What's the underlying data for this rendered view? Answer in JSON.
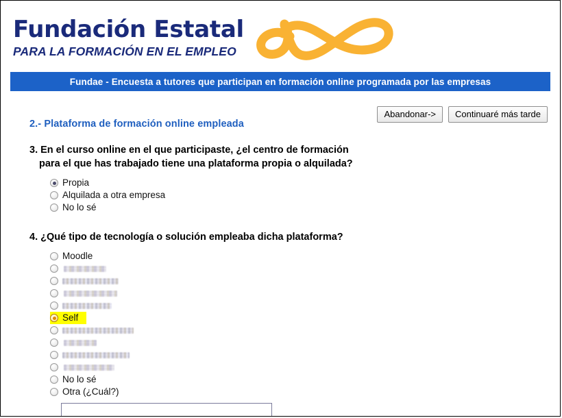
{
  "header": {
    "brand_title": "Fundación Estatal",
    "brand_subtitle": "PARA LA FORMACIÓN EN EL EMPLEO",
    "logo_icon": "fundae-swirl-logo",
    "brand_color": "#1a2a7a",
    "logo_color": "#f9b233"
  },
  "banner": {
    "text": "Fundae - Encuesta a tutores que participan en formación online programada por las empresas",
    "background_color": "#1c62c8",
    "text_color": "#ffffff"
  },
  "toolbar": {
    "abandon_label": "Abandonar->",
    "continue_later_label": "Continuaré más tarde"
  },
  "section": {
    "title": "2.- Plataforma de formación online empleada",
    "title_color": "#1f5fbf"
  },
  "questions": [
    {
      "number": "3.",
      "line1": "En el curso online en el que participaste, ¿el centro de formación",
      "line2": "para el que has trabajado tiene una plataforma propia o alquilada?",
      "options": [
        {
          "label": "Propia",
          "checked": true,
          "redacted": false,
          "highlighted": false
        },
        {
          "label": "Alquilada a otra empresa",
          "checked": false,
          "redacted": false,
          "highlighted": false
        },
        {
          "label": "No lo sé",
          "checked": false,
          "redacted": false,
          "highlighted": false
        }
      ]
    },
    {
      "number": "4.",
      "line1": "¿Qué tipo de tecnología o solución empleaba dicha plataforma?",
      "line2": "",
      "options": [
        {
          "label": "Moodle",
          "checked": false,
          "redacted": false,
          "highlighted": false
        },
        {
          "label": "",
          "checked": false,
          "redacted": true,
          "highlighted": false,
          "redacted_width": 62
        },
        {
          "label": "",
          "checked": false,
          "redacted": true,
          "highlighted": false,
          "redacted_width": 82
        },
        {
          "label": "",
          "checked": false,
          "redacted": true,
          "highlighted": false,
          "redacted_width": 78
        },
        {
          "label": "",
          "checked": false,
          "redacted": true,
          "highlighted": false,
          "redacted_width": 72
        },
        {
          "label": "Self",
          "checked": true,
          "redacted": false,
          "highlighted": true
        },
        {
          "label": "",
          "checked": false,
          "redacted": true,
          "highlighted": false,
          "redacted_width": 104
        },
        {
          "label": "",
          "checked": false,
          "redacted": true,
          "highlighted": false,
          "redacted_width": 48
        },
        {
          "label": "",
          "checked": false,
          "redacted": true,
          "highlighted": false,
          "redacted_width": 98
        },
        {
          "label": "",
          "checked": false,
          "redacted": true,
          "highlighted": false,
          "redacted_width": 74
        },
        {
          "label": "No lo sé",
          "checked": false,
          "redacted": false,
          "highlighted": false
        },
        {
          "label": "Otra (¿Cuál?)",
          "checked": false,
          "redacted": false,
          "highlighted": false
        }
      ],
      "other_input": {
        "value": "",
        "placeholder": ""
      }
    }
  ],
  "colors": {
    "highlight": "#ffff00",
    "selected_radio_dot": "#4a4a6a",
    "highlighted_radio_dot": "#e08a00",
    "page_border": "#000000"
  }
}
